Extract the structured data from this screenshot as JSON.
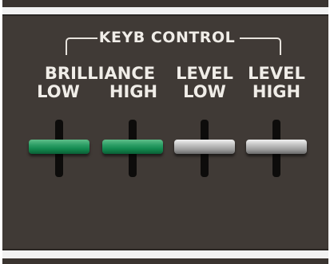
{
  "section": {
    "heading": "KEYB CONTROL"
  },
  "sliders": [
    {
      "line1": "BRILLIANCE",
      "line2": "LOW",
      "color": "#1a9158",
      "icon": "fader-knob-green"
    },
    {
      "line1": "",
      "line2": "HIGH",
      "color": "#1a9158",
      "icon": "fader-knob-green"
    },
    {
      "line1": "LEVEL",
      "line2": "LOW",
      "color": "#b4b4b4",
      "icon": "fader-knob-grey"
    },
    {
      "line1": "LEVEL",
      "line2": "HIGH",
      "color": "#b4b4b4",
      "icon": "fader-knob-grey"
    }
  ],
  "colors": {
    "panel": "#403a36",
    "text": "#f0ede8"
  }
}
